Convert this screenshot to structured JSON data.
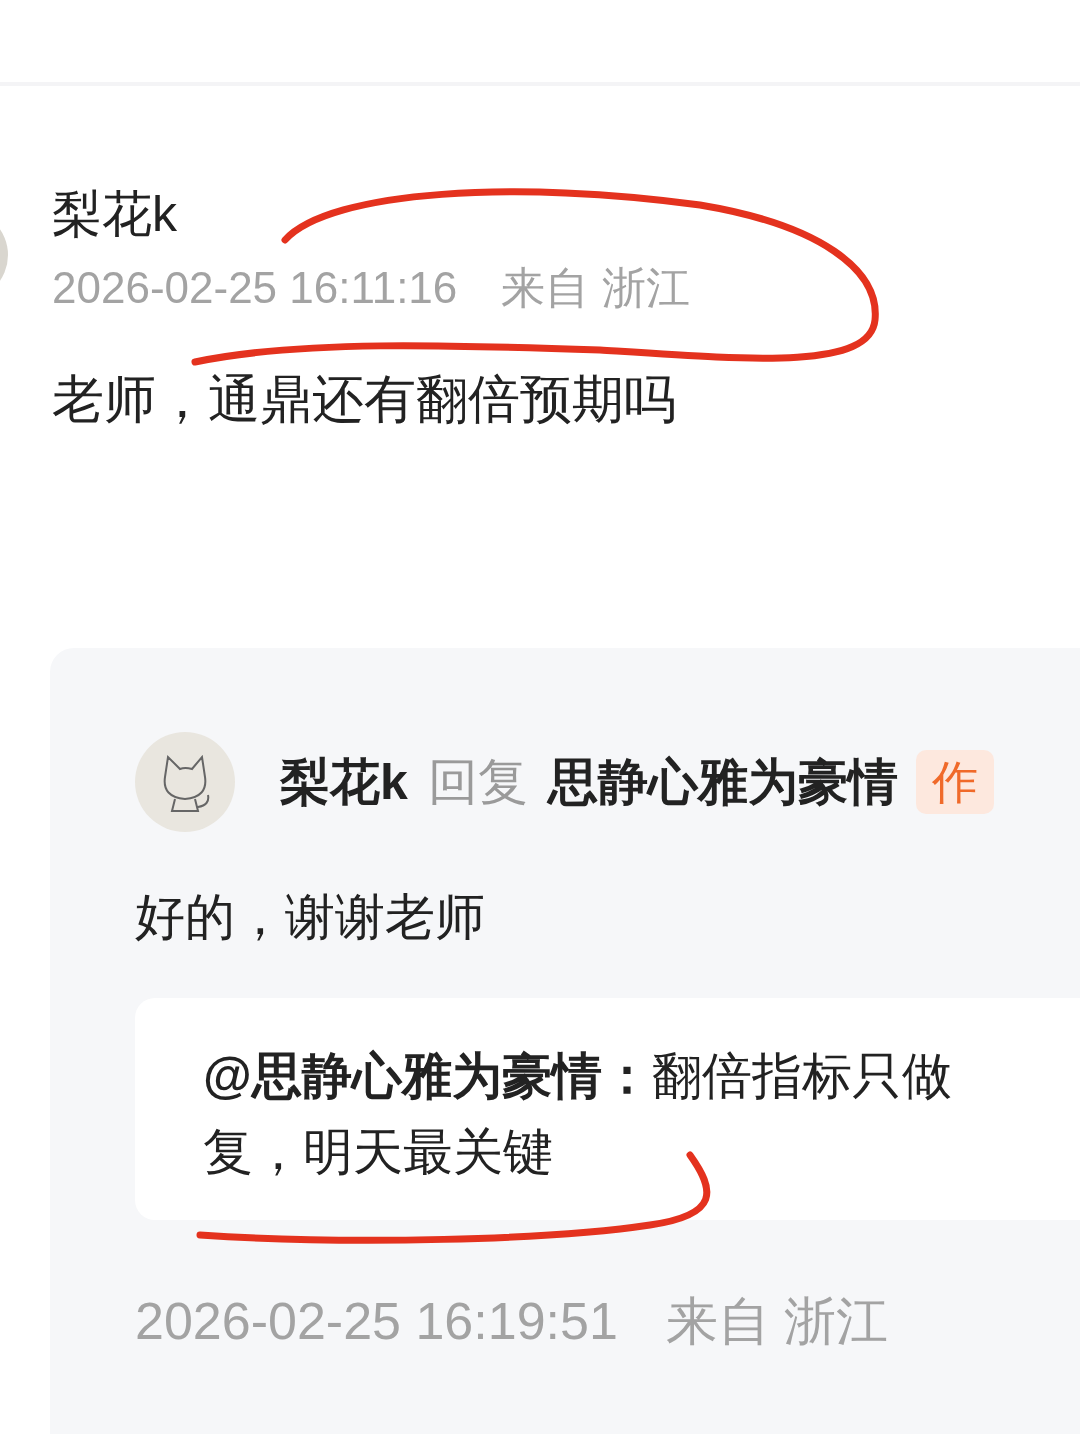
{
  "comment": {
    "author": "梨花k",
    "time": "2026-02-25 16:11:16",
    "location": "来自 浙江",
    "text": "老师，通鼎还有翻倍预期吗"
  },
  "reply": {
    "author": "梨花k",
    "action": "回复",
    "target": "思静心雅为豪情",
    "badge": "作",
    "text": "好的，谢谢老师",
    "quote": [
      "**@思静心雅为豪情：**翻倍指标只做",
      "复，明天最关键"
    ],
    "time": "2026-02-25 16:19:51",
    "location": "来自 浙江"
  }
}
